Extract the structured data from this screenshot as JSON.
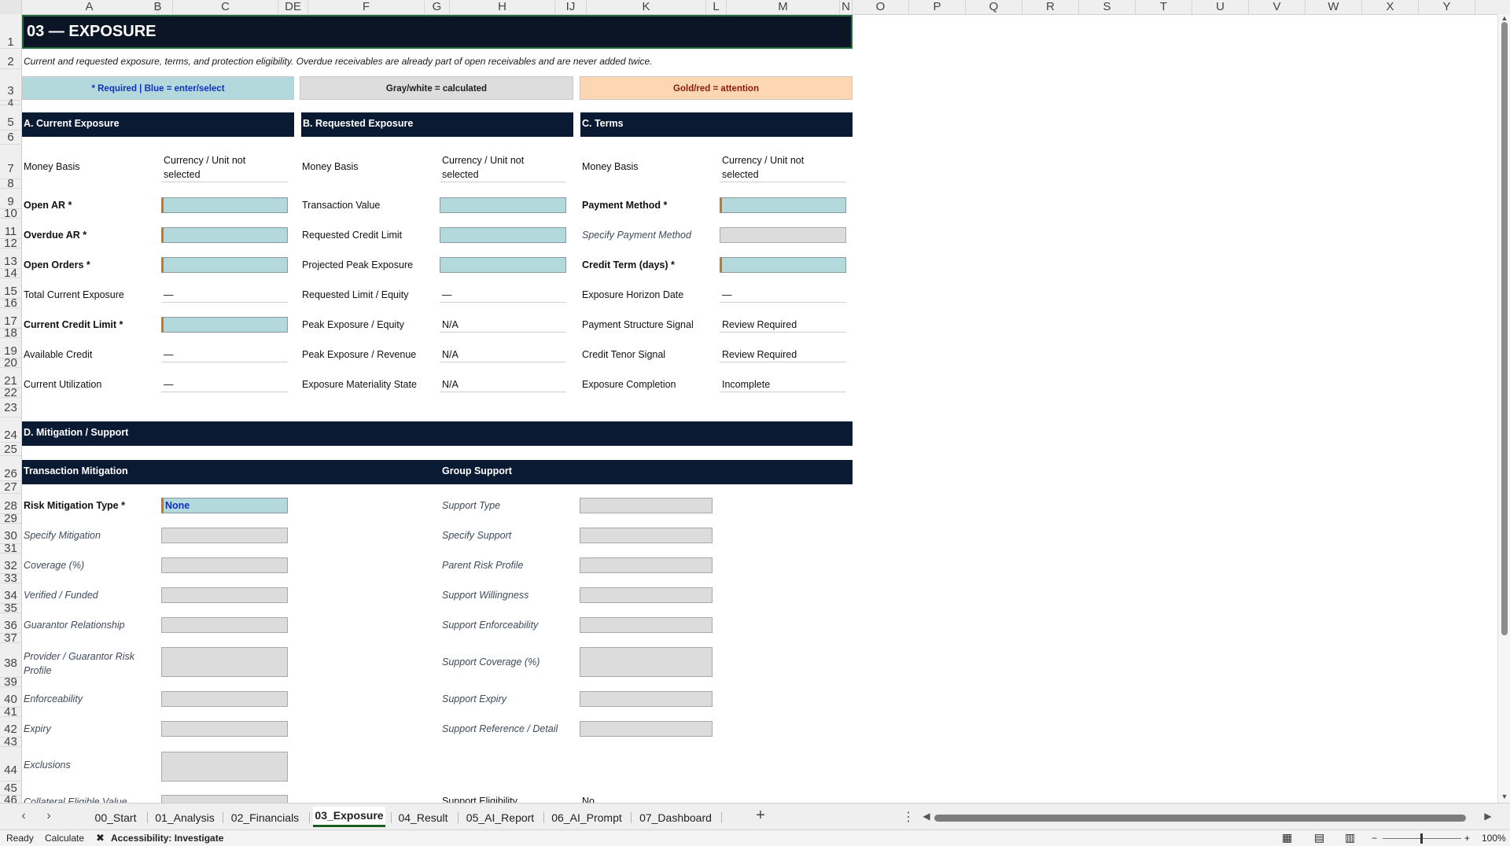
{
  "columns": [
    "A",
    "B",
    "C",
    "DE",
    "F",
    "G",
    "H",
    "IJ",
    "K",
    "L",
    "M",
    "N",
    "O",
    "P",
    "Q",
    "R",
    "S",
    "T",
    "U",
    "V",
    "W",
    "X",
    "Y"
  ],
  "rows": [
    "1",
    "2",
    "3",
    "4",
    "5",
    "6",
    "7",
    "8",
    "9",
    "10",
    "11",
    "12",
    "13",
    "14",
    "15",
    "16",
    "17",
    "18",
    "19",
    "20",
    "21",
    "22",
    "23",
    "24",
    "25",
    "26",
    "27",
    "28",
    "29",
    "30",
    "31",
    "32",
    "33",
    "34",
    "35",
    "36",
    "37",
    "38",
    "39",
    "40",
    "41",
    "42",
    "43",
    "44",
    "45",
    "46"
  ],
  "title": "03 — EXPOSURE",
  "subtitle": "Current and requested exposure, terms, and protection eligibility. Overdue receivables are already part of open receivables and are never added twice.",
  "legend": {
    "blue": "* Required | Blue = enter/select",
    "gray": "Gray/white = calculated",
    "gold": "Gold/red = attention"
  },
  "sections": {
    "a": "A. Current Exposure",
    "b": "B. Requested Exposure",
    "c": "C. Terms",
    "d": "D. Mitigation / Support",
    "transaction": "Transaction Mitigation",
    "group": "Group Support"
  },
  "current": {
    "money_basis": "Money Basis",
    "money_basis_value": "Currency / Unit not selected",
    "open_ar": "Open AR *",
    "overdue_ar": "Overdue AR *",
    "open_orders": "Open Orders *",
    "total_exposure": "Total Current Exposure",
    "total_exposure_value": "—",
    "credit_limit": "Current Credit Limit *",
    "available_credit": "Available Credit",
    "available_credit_value": "—",
    "utilization": "Current Utilization",
    "utilization_value": "—"
  },
  "requested": {
    "money_basis": "Money Basis",
    "money_basis_value": "Currency / Unit not selected",
    "transaction_value": "Transaction Value",
    "requested_limit": "Requested Credit Limit",
    "peak_exposure": "Projected Peak Exposure",
    "limit_equity": "Requested Limit / Equity",
    "limit_equity_value": "—",
    "peak_equity": "Peak Exposure / Equity",
    "peak_equity_value": "N/A",
    "peak_revenue": "Peak Exposure / Revenue",
    "peak_revenue_value": "N/A",
    "materiality": "Exposure Materiality State",
    "materiality_value": "N/A"
  },
  "terms": {
    "money_basis": "Money Basis",
    "money_basis_value": "Currency / Unit not selected",
    "payment_method": "Payment Method *",
    "specify_payment": "Specify Payment Method",
    "credit_term": "Credit Term (days) *",
    "horizon_date": "Exposure Horizon Date",
    "horizon_date_value": "—",
    "payment_signal": "Payment Structure Signal",
    "payment_signal_value": "Review Required",
    "tenor_signal": "Credit Tenor Signal",
    "tenor_signal_value": "Review Required",
    "completion": "Exposure Completion",
    "completion_value": "Incomplete"
  },
  "mitigation": {
    "risk_type": "Risk Mitigation Type *",
    "risk_type_value": "None",
    "specify": "Specify Mitigation",
    "coverage": "Coverage (%)",
    "verified": "Verified / Funded",
    "guarantor": "Guarantor Relationship",
    "provider_risk": "Provider / Guarantor Risk Profile",
    "enforceability": "Enforceability",
    "expiry": "Expiry",
    "exclusions": "Exclusions",
    "collateral": "Collateral Eligible Value"
  },
  "support": {
    "type": "Support Type",
    "specify": "Specify Support",
    "parent_risk": "Parent Risk Profile",
    "willingness": "Support Willingness",
    "enforceability": "Support Enforceability",
    "coverage": "Support Coverage (%)",
    "expiry": "Support Expiry",
    "reference": "Support Reference / Detail",
    "eligibility": "Support Eligibility",
    "eligibility_value": "No"
  },
  "tabs": [
    "00_Start",
    "01_Analysis",
    "02_Financials",
    "03_Exposure",
    "04_Result",
    "05_AI_Report",
    "06_AI_Prompt",
    "07_Dashboard"
  ],
  "active_tab": "03_Exposure",
  "status": {
    "ready": "Ready",
    "calculate": "Calculate",
    "accessibility": "Accessibility: Investigate",
    "zoom": "100%"
  },
  "colors": {
    "header_navy": "#0b1a33",
    "input_blue": "#b3d9dc",
    "calc_gray": "#dddddd",
    "attention_gold": "#fdd6b3",
    "active_tab_green": "#1b5e20"
  }
}
